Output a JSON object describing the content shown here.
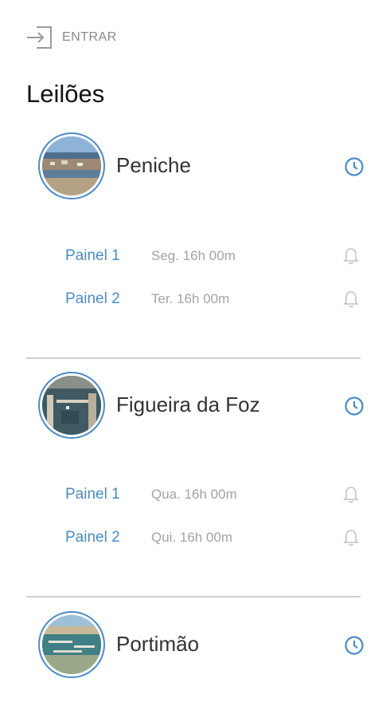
{
  "header": {
    "login_label": "ENTRAR",
    "title": "Leilões"
  },
  "ports": [
    {
      "name": "Peniche",
      "panels": [
        {
          "name": "Painel 1",
          "time": "Seg. 16h 00m"
        },
        {
          "name": "Painel 2",
          "time": "Ter. 16h 00m"
        }
      ]
    },
    {
      "name": "Figueira da Foz",
      "panels": [
        {
          "name": "Painel 1",
          "time": "Qua. 16h 00m"
        },
        {
          "name": "Painel 2",
          "time": "Qui. 16h 00m"
        }
      ]
    },
    {
      "name": "Portimão",
      "panels": []
    }
  ],
  "icons": {
    "login": "login-arrow-icon",
    "schedule": "clock-icon",
    "notify": "bell-icon"
  },
  "colors": {
    "accent": "#4a8bc6",
    "muted_text": "#a3a3a3",
    "divider": "#d0d0d0"
  }
}
